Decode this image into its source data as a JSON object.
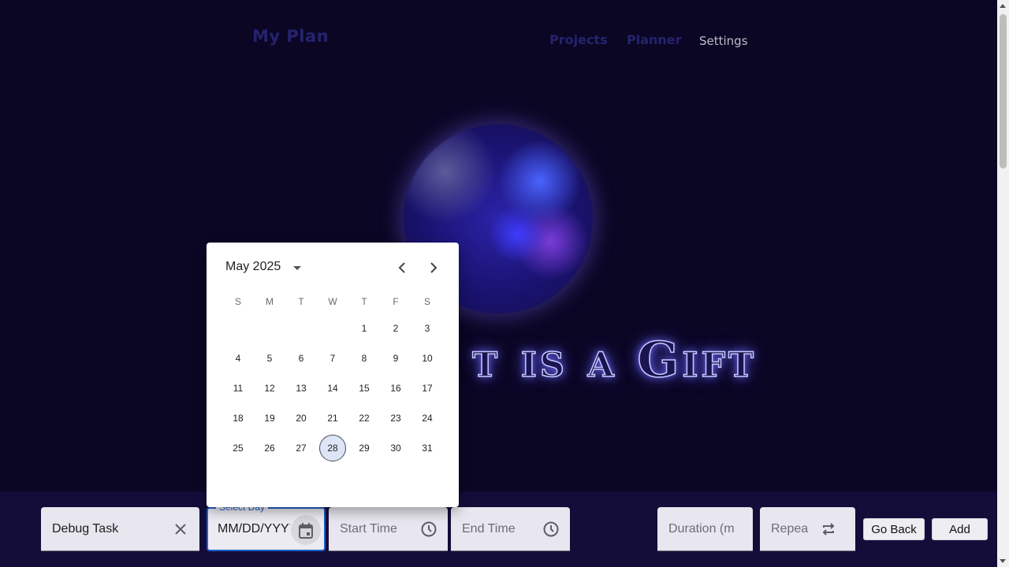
{
  "header": {
    "brand": "My Plan",
    "nav": {
      "projects": "Projects",
      "planner": "Planner",
      "settings": "Settings"
    }
  },
  "hero": {
    "text": "Present is a Gift",
    "visible_text": "t is a Gift"
  },
  "form": {
    "task_value": "Debug Task",
    "select_day_label": "Select Day",
    "select_day_placeholder": "MM/DD/YYYY",
    "start_time_placeholder": "Start Time",
    "end_time_placeholder": "End Time",
    "duration_placeholder": "Duration (m",
    "repeat_placeholder": "Repea",
    "go_back": "Go Back",
    "add": "Add"
  },
  "calendar": {
    "month_label": "May 2025",
    "weekdays": [
      "S",
      "M",
      "T",
      "W",
      "T",
      "F",
      "S"
    ],
    "weeks": [
      [
        "",
        "",
        "",
        "",
        "1",
        "2",
        "3"
      ],
      [
        "4",
        "5",
        "6",
        "7",
        "8",
        "9",
        "10"
      ],
      [
        "11",
        "12",
        "13",
        "14",
        "15",
        "16",
        "17"
      ],
      [
        "18",
        "19",
        "20",
        "21",
        "22",
        "23",
        "24"
      ],
      [
        "25",
        "26",
        "27",
        "28",
        "29",
        "30",
        "31"
      ]
    ],
    "today": "28",
    "prev_icon": "chevron-left-icon",
    "next_icon": "chevron-right-icon"
  },
  "colors": {
    "background": "#0b0624",
    "accent": "#1e5fc8",
    "nav_active": "#25236e"
  }
}
